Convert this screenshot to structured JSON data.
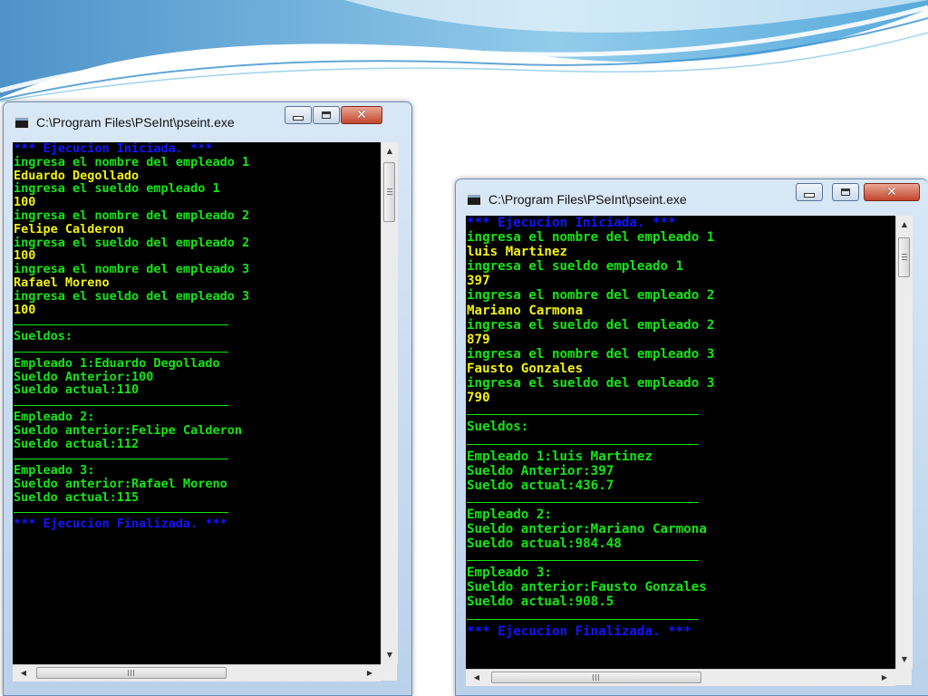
{
  "colors": {
    "console_bg": "#000000",
    "blue": "#1414ff",
    "green": "#13e613",
    "yellow": "#f2f20c"
  },
  "windows": [
    {
      "title": "C:\\Program Files\\PSeInt\\pseint.exe",
      "icons": {
        "app": "console-app-icon",
        "minimize": "minimize-icon",
        "maximize": "maximize-icon",
        "close": "close-icon"
      },
      "lines": [
        {
          "t": "*** Ejecucion Iniciada. ***",
          "c": "blue"
        },
        {
          "t": "ingresa el nombre del empleado 1",
          "c": "green"
        },
        {
          "t": "Eduardo Degollado",
          "c": "yellow"
        },
        {
          "t": "ingresa el sueldo empleado 1",
          "c": "green"
        },
        {
          "t": "100",
          "c": "yellow"
        },
        {
          "t": "ingresa el nombre del empleado 2",
          "c": "green"
        },
        {
          "t": "Felipe Calderon",
          "c": "yellow"
        },
        {
          "t": "ingresa el sueldo del empleado 2",
          "c": "green"
        },
        {
          "t": "100",
          "c": "yellow"
        },
        {
          "t": "ingresa el nombre del empleado 3",
          "c": "green"
        },
        {
          "t": "Rafael Moreno",
          "c": "yellow"
        },
        {
          "t": "ingresa el sueldo del empleado 3",
          "c": "green"
        },
        {
          "t": "100",
          "c": "yellow"
        },
        {
          "t": "",
          "c": "sep"
        },
        {
          "t": "Sueldos:",
          "c": "green"
        },
        {
          "t": "",
          "c": "sep"
        },
        {
          "t": "Empleado 1:Eduardo Degollado",
          "c": "green"
        },
        {
          "t": "Sueldo Anterior:100",
          "c": "green"
        },
        {
          "t": "Sueldo actual:110",
          "c": "green"
        },
        {
          "t": "",
          "c": "sep"
        },
        {
          "t": "Empleado 2:",
          "c": "green"
        },
        {
          "t": "Sueldo anterior:Felipe Calderon",
          "c": "green"
        },
        {
          "t": "Sueldo actual:112",
          "c": "green"
        },
        {
          "t": "",
          "c": "sep"
        },
        {
          "t": "Empleado 3:",
          "c": "green"
        },
        {
          "t": "Sueldo anterior:Rafael Moreno",
          "c": "green"
        },
        {
          "t": "Sueldo actual:115",
          "c": "green"
        },
        {
          "t": "",
          "c": "sep"
        },
        {
          "t": "*** Ejecucion Finalizada. ***",
          "c": "blue"
        }
      ]
    },
    {
      "title": "C:\\Program Files\\PSeInt\\pseint.exe",
      "icons": {
        "app": "console-app-icon",
        "minimize": "minimize-icon",
        "maximize": "maximize-icon",
        "close": "close-icon"
      },
      "lines": [
        {
          "t": "*** Ejecucion Iniciada. ***",
          "c": "blue"
        },
        {
          "t": "ingresa el nombre del empleado 1",
          "c": "green"
        },
        {
          "t": "luis Martinez",
          "c": "yellow"
        },
        {
          "t": "ingresa el sueldo empleado 1",
          "c": "green"
        },
        {
          "t": "397",
          "c": "yellow"
        },
        {
          "t": "ingresa el nombre del empleado 2",
          "c": "green"
        },
        {
          "t": "Mariano Carmona",
          "c": "yellow"
        },
        {
          "t": "ingresa el sueldo del empleado 2",
          "c": "green"
        },
        {
          "t": "879",
          "c": "yellow"
        },
        {
          "t": "ingresa el nombre del empleado 3",
          "c": "green"
        },
        {
          "t": "Fausto Gonzales",
          "c": "yellow"
        },
        {
          "t": "ingresa el sueldo del empleado 3",
          "c": "green"
        },
        {
          "t": "790",
          "c": "yellow"
        },
        {
          "t": "",
          "c": "sep"
        },
        {
          "t": "Sueldos:",
          "c": "green"
        },
        {
          "t": "",
          "c": "sep"
        },
        {
          "t": "Empleado 1:luis Martinez",
          "c": "green"
        },
        {
          "t": "Sueldo Anterior:397",
          "c": "green"
        },
        {
          "t": "Sueldo actual:436.7",
          "c": "green"
        },
        {
          "t": "",
          "c": "sep"
        },
        {
          "t": "Empleado 2:",
          "c": "green"
        },
        {
          "t": "Sueldo anterior:Mariano Carmona",
          "c": "green"
        },
        {
          "t": "Sueldo actual:984.48",
          "c": "green"
        },
        {
          "t": "",
          "c": "sep"
        },
        {
          "t": "Empleado 3:",
          "c": "green"
        },
        {
          "t": "Sueldo anterior:Fausto Gonzales",
          "c": "green"
        },
        {
          "t": "Sueldo actual:908.5",
          "c": "green"
        },
        {
          "t": "",
          "c": "sep"
        },
        {
          "t": "*** Ejecucion Finalizada. ***",
          "c": "blue"
        }
      ]
    }
  ]
}
